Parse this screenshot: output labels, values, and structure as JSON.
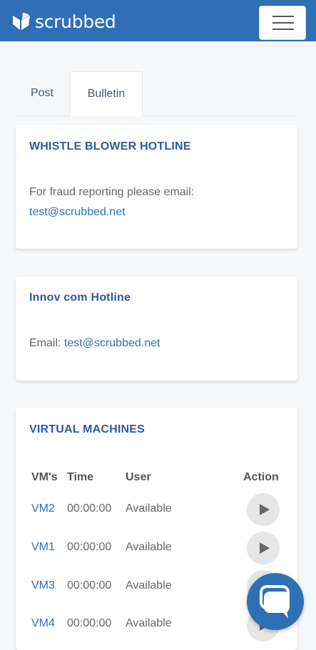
{
  "brand": {
    "name": "scrubbed"
  },
  "colors": {
    "primary": "#2f6fb6",
    "title": "#2c5aa0"
  },
  "nav": {
    "menu_icon": "hamburger-menu-icon"
  },
  "tabs": [
    {
      "label": "Post",
      "active": false
    },
    {
      "label": "Bulletin",
      "active": true
    }
  ],
  "cards": {
    "whistle": {
      "title": "WHISTLE BLOWER HOTLINE",
      "text": "For fraud reporting please email:",
      "email": "test@scrubbed.net"
    },
    "innov": {
      "title": "Innov com Hotline",
      "label": "Email:",
      "email": "test@scrubbed.net"
    },
    "vms": {
      "title": "VIRTUAL MACHINES",
      "headers": {
        "vm": "VM's",
        "time": "Time",
        "user": "User",
        "action": "Action"
      },
      "rows": [
        {
          "vm": "VM2",
          "time": "00:00:00",
          "user": "Available"
        },
        {
          "vm": "VM1",
          "time": "00:00:00",
          "user": "Available"
        },
        {
          "vm": "VM3",
          "time": "00:00:00",
          "user": "Available"
        },
        {
          "vm": "VM4",
          "time": "00:00:00",
          "user": "Available"
        }
      ]
    }
  },
  "chat": {
    "icon": "chat-bubble-icon"
  }
}
